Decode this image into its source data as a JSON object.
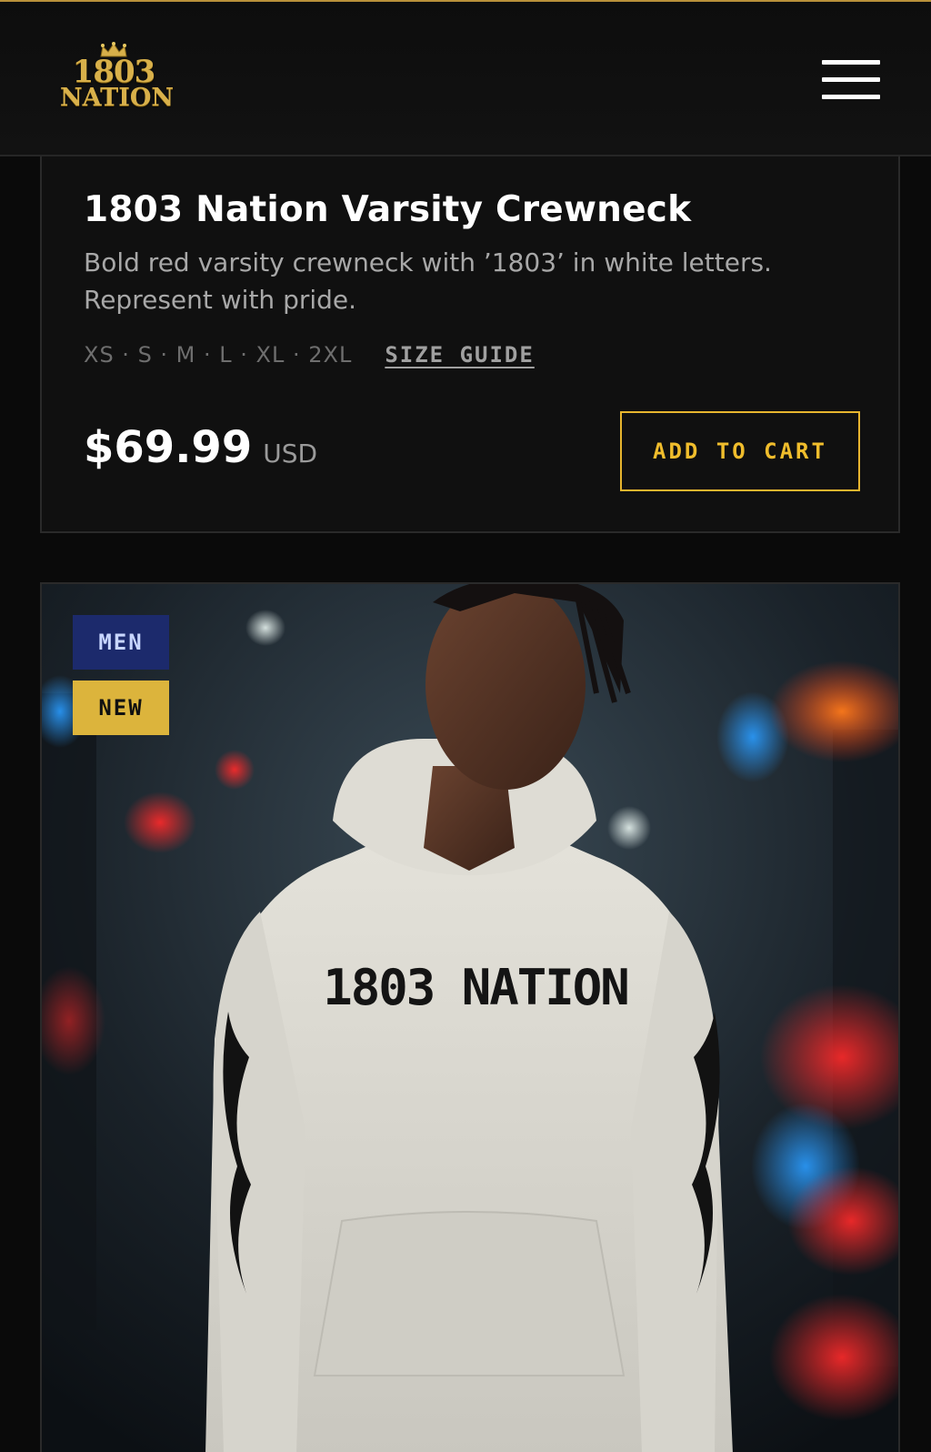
{
  "header": {
    "logo": {
      "line1": "1803",
      "line2": "NATION"
    },
    "menu_icon": "hamburger-menu-icon"
  },
  "product": {
    "title": "1803 Nation Varsity Crewneck",
    "description": "Bold red varsity crewneck with ’1803’ in white letters. Represent with pride.",
    "sizes": "XS · S · M · L · XL · 2XL",
    "size_guide_label": "SIZE GUIDE",
    "price": "$69.99",
    "currency": "USD",
    "add_to_cart_label": "ADD TO CART"
  },
  "next_product": {
    "badges": {
      "category": "MEN",
      "status": "NEW"
    },
    "image_text": "1803 NATION"
  },
  "colors": {
    "background": "#0a0a0a",
    "accent_gold": "#f0bd2c",
    "badge_men_bg": "#1c2a6c",
    "badge_new_bg": "#dcb43c"
  }
}
